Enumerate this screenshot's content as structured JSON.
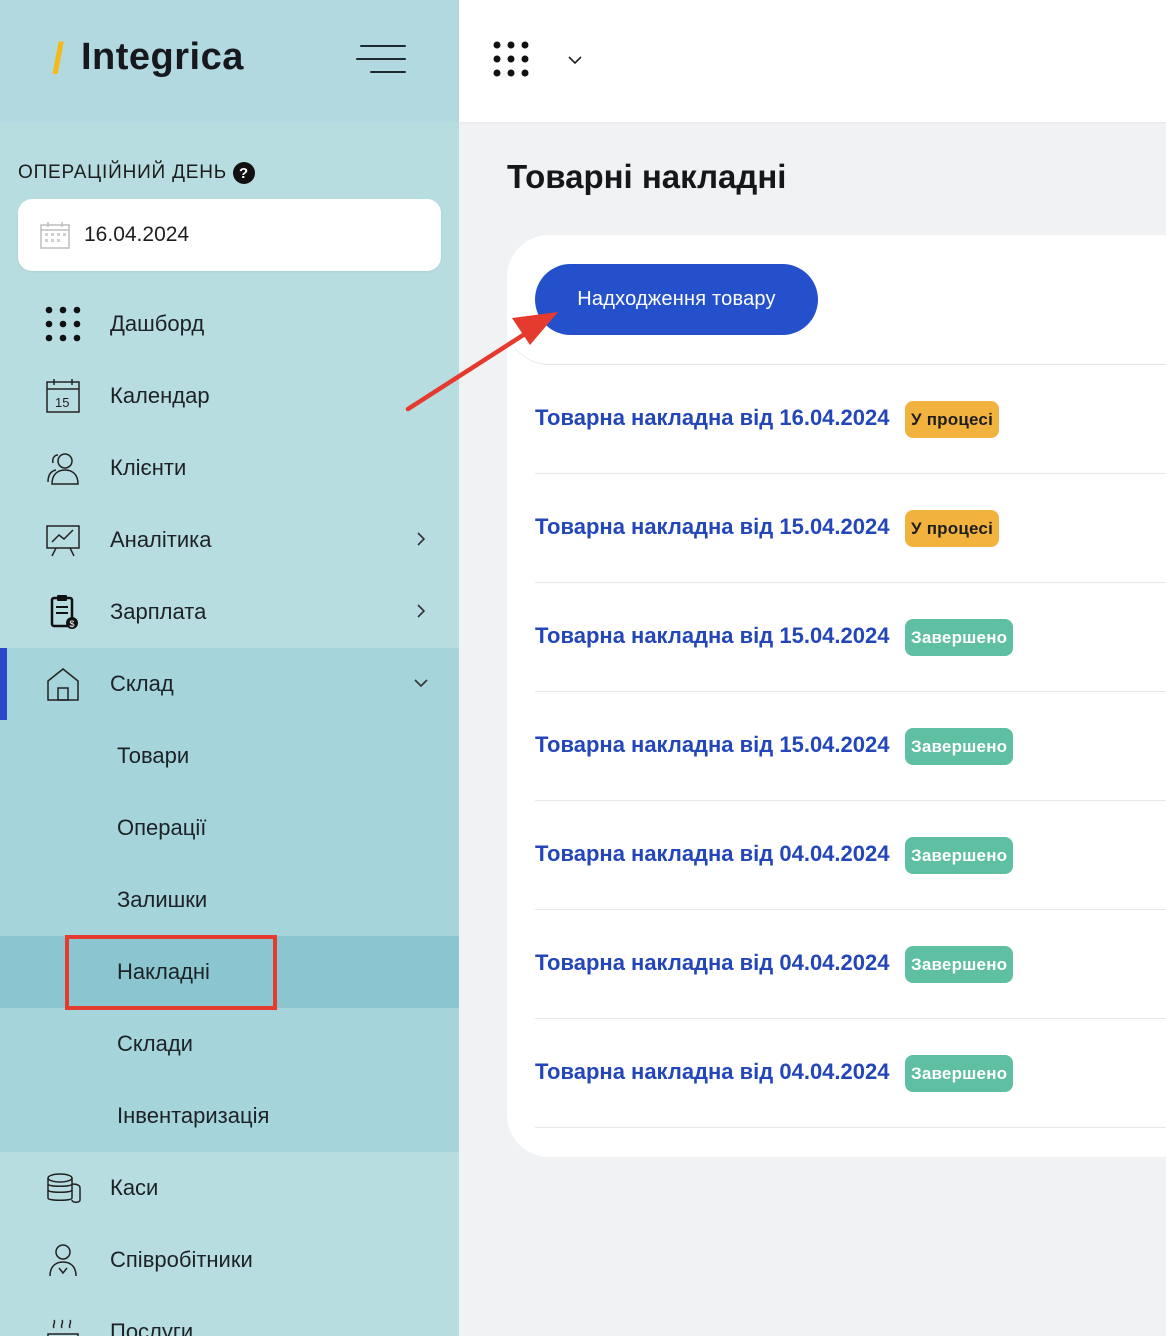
{
  "brand": {
    "slash": "/",
    "name": "Integrica"
  },
  "sidebar": {
    "opday_label": "ОПЕРАЦІЙНИЙ ДЕНЬ",
    "date": "16.04.2024",
    "items": [
      {
        "label": "Дашборд",
        "icon": "dashboard-grid-icon"
      },
      {
        "label": "Календар",
        "icon": "calendar-icon"
      },
      {
        "label": "Клієнти",
        "icon": "clients-icon"
      },
      {
        "label": "Аналітика",
        "icon": "analytics-icon"
      },
      {
        "label": "Зарплата",
        "icon": "salary-icon"
      },
      {
        "label": "Склад",
        "icon": "warehouse-icon"
      },
      {
        "label": "Каси",
        "icon": "cash-icon"
      },
      {
        "label": "Співробітники",
        "icon": "employees-icon"
      },
      {
        "label": "Послуги",
        "icon": "services-icon"
      }
    ],
    "sub_items": [
      {
        "label": "Товари"
      },
      {
        "label": "Операції"
      },
      {
        "label": "Залишки"
      },
      {
        "label": "Накладні"
      },
      {
        "label": "Склади"
      },
      {
        "label": "Інвентаризація"
      }
    ]
  },
  "main": {
    "title": "Товарні накладні",
    "primary_button": "Надходження товару",
    "rows": [
      {
        "title": "Товарна накладна від 16.04.2024",
        "status": "У процесі",
        "state": "progress"
      },
      {
        "title": "Товарна накладна від 15.04.2024",
        "status": "У процесі",
        "state": "progress"
      },
      {
        "title": "Товарна накладна від 15.04.2024",
        "status": "Завершено",
        "state": "done"
      },
      {
        "title": "Товарна накладна від 15.04.2024",
        "status": "Завершено",
        "state": "done"
      },
      {
        "title": "Товарна накладна від 04.04.2024",
        "status": "Завершено",
        "state": "done"
      },
      {
        "title": "Товарна накладна від 04.04.2024",
        "status": "Завершено",
        "state": "done"
      },
      {
        "title": "Товарна накладна від 04.04.2024",
        "status": "Завершено",
        "state": "done"
      }
    ]
  },
  "colors": {
    "sidebar_bg": "#b7dde1",
    "accent_blue": "#2450cc",
    "link_blue": "#2346b8",
    "status_progress": "#f2b33e",
    "status_done": "#5fbfa2",
    "annotation_red": "#e53a2e",
    "brand_slash": "#f5b91c"
  }
}
